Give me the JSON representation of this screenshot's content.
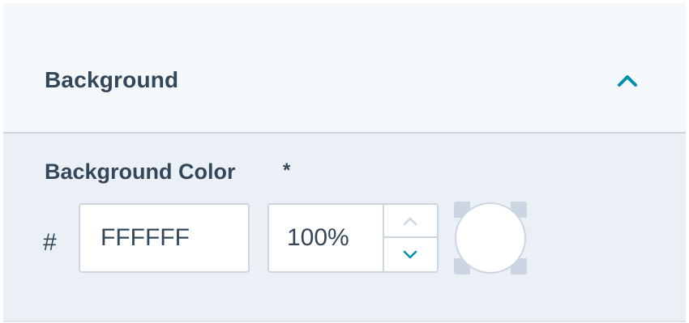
{
  "section": {
    "title": "Background",
    "expanded": true,
    "toggle_icon": "chevron-up-icon"
  },
  "field": {
    "label": "Background Color",
    "required_marker": "*",
    "hash_prefix": "#",
    "hex_value": "FFFFFF",
    "opacity_value": "100%",
    "swatch_color": "#ffffff"
  },
  "colors": {
    "accent": "#0091ae",
    "text": "#33475b",
    "border": "#cbd6e2",
    "panel_bg": "#eaf0f6",
    "header_bg": "#f5f8fa"
  },
  "icons": {
    "step_up": "chevron-up-icon",
    "step_down": "chevron-down-icon"
  }
}
